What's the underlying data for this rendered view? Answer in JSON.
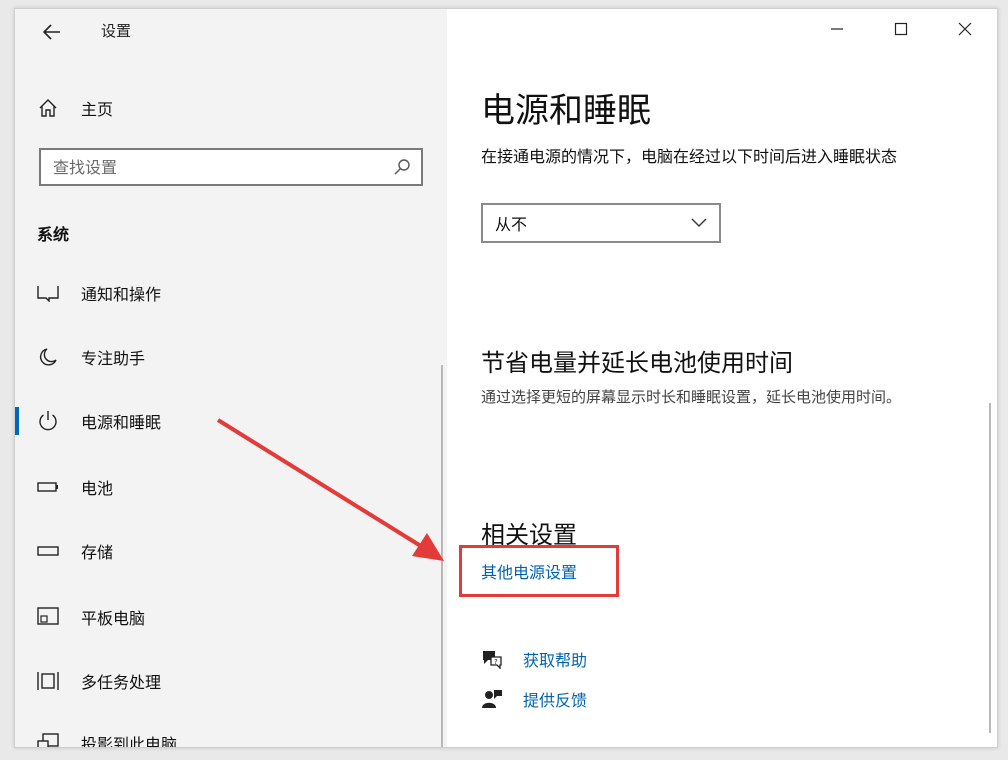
{
  "window": {
    "title": "设置"
  },
  "sidebar": {
    "home_label": "主页",
    "search_placeholder": "查找设置",
    "section_label": "系统",
    "items": [
      {
        "label": "通知和操作",
        "icon": "notification-icon"
      },
      {
        "label": "专注助手",
        "icon": "moon-icon"
      },
      {
        "label": "电源和睡眠",
        "icon": "power-icon",
        "active": true
      },
      {
        "label": "电池",
        "icon": "battery-icon"
      },
      {
        "label": "存储",
        "icon": "storage-icon"
      },
      {
        "label": "平板电脑",
        "icon": "tablet-icon"
      },
      {
        "label": "多任务处理",
        "icon": "multitask-icon"
      },
      {
        "label": "投影到此电脑",
        "icon": "project-icon"
      }
    ]
  },
  "main": {
    "title": "电源和睡眠",
    "sleep_description": "在接通电源的情况下，电脑在经过以下时间后进入睡眠状态",
    "sleep_dropdown_value": "从不",
    "battery_heading": "节省电量并延长电池使用时间",
    "battery_description": "通过选择更短的屏幕显示时长和睡眠设置，延长电池使用时间。",
    "related_heading": "相关设置",
    "power_link": "其他电源设置",
    "help_link": "获取帮助",
    "feedback_link": "提供反馈"
  },
  "colors": {
    "accent": "#0067c0",
    "link": "#0063b1",
    "highlight": "#e33a3a"
  }
}
